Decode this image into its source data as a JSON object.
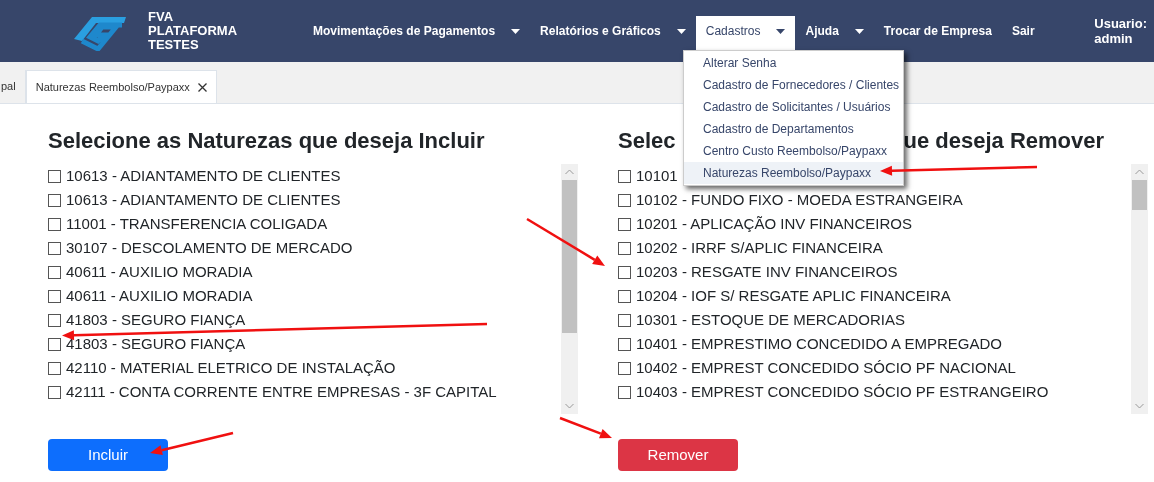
{
  "navbar": {
    "brand": [
      "FVA",
      "PLATAFORMA",
      "TESTES"
    ],
    "items": [
      {
        "label": "Movimentações de Pagamentos",
        "dropdown": true,
        "selected": false
      },
      {
        "label": "Relatórios e Gráficos",
        "dropdown": true,
        "selected": false
      },
      {
        "label": "Cadastros",
        "dropdown": true,
        "selected": true
      },
      {
        "label": "Ajuda",
        "dropdown": true,
        "selected": false
      },
      {
        "label": "Trocar de Empresa",
        "dropdown": false,
        "selected": false
      },
      {
        "label": "Sair",
        "dropdown": false,
        "selected": false
      }
    ],
    "user": [
      "Usuario:",
      "admin"
    ]
  },
  "dropdown_menu": [
    {
      "label": "Alterar Senha",
      "selected": false
    },
    {
      "label": "Cadastro de Fornecedores / Clientes",
      "selected": false
    },
    {
      "label": "Cadastro de Solicitantes / Usuários",
      "selected": false
    },
    {
      "label": "Cadastro de Departamentos",
      "selected": false
    },
    {
      "label": "Centro Custo Reembolso/Paypaxx",
      "selected": false
    },
    {
      "label": "Naturezas Reembolso/Paypaxx",
      "selected": true
    }
  ],
  "tabs": [
    {
      "label": "pal",
      "selected": false,
      "closable": false
    },
    {
      "label": "Naturezas Reembolso/Paypaxx",
      "selected": true,
      "closable": true
    }
  ],
  "panels": [
    {
      "title": [
        "Selecione as Naturezas que deseja Incluir"
      ],
      "button": "Incluir",
      "kind": "include",
      "items": [
        {
          "label": "10613 - ADIANTAMENTO DE CLIENTES",
          "checked": false
        },
        {
          "label": "10613 - ADIANTAMENTO DE CLIENTES",
          "checked": false
        },
        {
          "label": "11001 - TRANSFERENCIA COLIGADA",
          "checked": false
        },
        {
          "label": "30107 - DESCOLAMENTO DE MERCADO",
          "checked": false
        },
        {
          "label": "40611 - AUXILIO MORADIA",
          "checked": false
        },
        {
          "label": "40611 - AUXILIO MORADIA",
          "checked": false
        },
        {
          "label": "41803 - SEGURO FIANÇA",
          "checked": false
        },
        {
          "label": "41803 - SEGURO FIANÇA",
          "checked": false
        },
        {
          "label": "42110 - MATERIAL ELETRICO DE INSTALAÇÃO",
          "checked": false
        },
        {
          "label": "42111 - CONTA CORRENTE ENTRE EMPRESAS - 3F CAPITAL",
          "checked": false
        }
      ]
    },
    {
      "title": [
        "Selec",
        "ue deseja Remover"
      ],
      "button": "Remover",
      "kind": "remove",
      "items": [
        {
          "label": "10101",
          "checked": false
        },
        {
          "label": "10102 - FUNDO FIXO - MOEDA ESTRANGEIRA",
          "checked": false
        },
        {
          "label": "10201 - APLICAÇÃO INV FINANCEIROS",
          "checked": false
        },
        {
          "label": "10202 - IRRF S/APLIC FINANCEIRA",
          "checked": false
        },
        {
          "label": "10203 - RESGATE INV FINANCEIROS",
          "checked": false
        },
        {
          "label": "10204 - IOF S/ RESGATE APLIC FINANCEIRA",
          "checked": false
        },
        {
          "label": "10301 - ESTOQUE DE MERCADORIAS",
          "checked": false
        },
        {
          "label": "10401 - EMPRESTIMO CONCEDIDO A EMPREGADO",
          "checked": false
        },
        {
          "label": "10402 - EMPREST CONCEDIDO SÓCIO PF NACIONAL",
          "checked": false
        },
        {
          "label": "10403 - EMPREST CONCEDIDO SÓCIO PF ESTRANGEIRO",
          "checked": false
        }
      ]
    }
  ]
}
